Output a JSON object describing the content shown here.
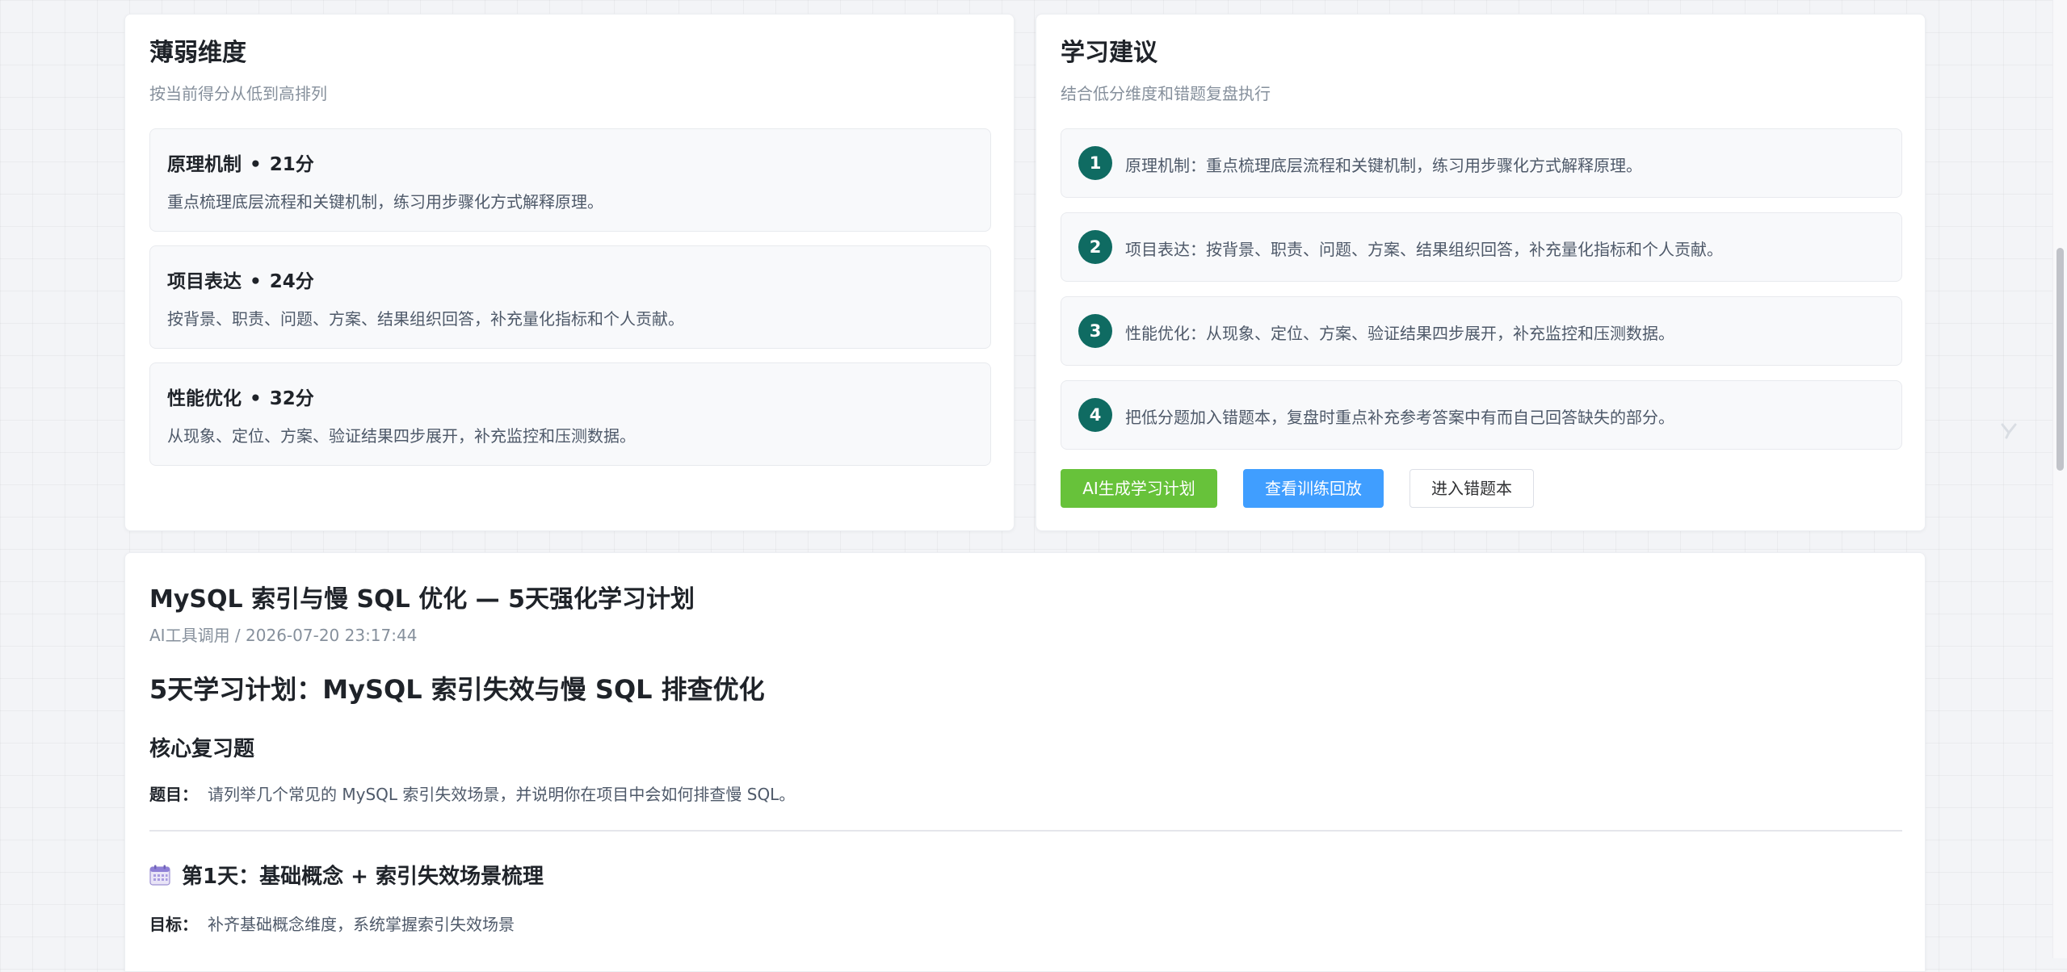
{
  "weak": {
    "title": "薄弱维度",
    "subtitle": "按当前得分从低到高排列",
    "separator": "•",
    "items": [
      {
        "name": "原理机制",
        "score": "21分",
        "desc": "重点梳理底层流程和关键机制，练习用步骤化方式解释原理。"
      },
      {
        "name": "项目表达",
        "score": "24分",
        "desc": "按背景、职责、问题、方案、结果组织回答，补充量化指标和个人贡献。"
      },
      {
        "name": "性能优化",
        "score": "32分",
        "desc": "从现象、定位、方案、验证结果四步展开，补充监控和压测数据。"
      }
    ]
  },
  "advice": {
    "title": "学习建议",
    "subtitle": "结合低分维度和错题复盘执行",
    "items": [
      {
        "num": "1",
        "text": "原理机制：重点梳理底层流程和关键机制，练习用步骤化方式解释原理。"
      },
      {
        "num": "2",
        "text": "项目表达：按背景、职责、问题、方案、结果组织回答，补充量化指标和个人贡献。"
      },
      {
        "num": "3",
        "text": "性能优化：从现象、定位、方案、验证结果四步展开，补充监控和压测数据。"
      },
      {
        "num": "4",
        "text": "把低分题加入错题本，复盘时重点补充参考答案中有而自己回答缺失的部分。"
      }
    ],
    "buttons": {
      "ai_plan": "AI生成学习计划",
      "replay": "查看训练回放",
      "mistakes": "进入错题本"
    }
  },
  "plan": {
    "title": "MySQL 索引与慢 SQL 优化 — 5天强化学习计划",
    "meta": "AI工具调用 / 2026-07-20 23:17:44",
    "heading": "5天学习计划：MySQL 索引失效与慢 SQL 排查优化",
    "section_title": "核心复习题",
    "question_label": "题目：",
    "question_text": "请列举几个常见的 MySQL 索引失效场景，并说明你在项目中会如何排查慢 SQL。",
    "day1_title": "第1天：基础概念 + 索引失效场景梳理",
    "goal_label": "目标：",
    "goal_text": "补齐基础概念维度，系统掌握索引失效场景"
  },
  "colors": {
    "accent_teal": "#0f6b62",
    "success_green": "#67c23a",
    "primary_blue": "#409eff"
  },
  "icons": {
    "calendar": "calendar-icon",
    "floating": "brand-logo-icon"
  }
}
